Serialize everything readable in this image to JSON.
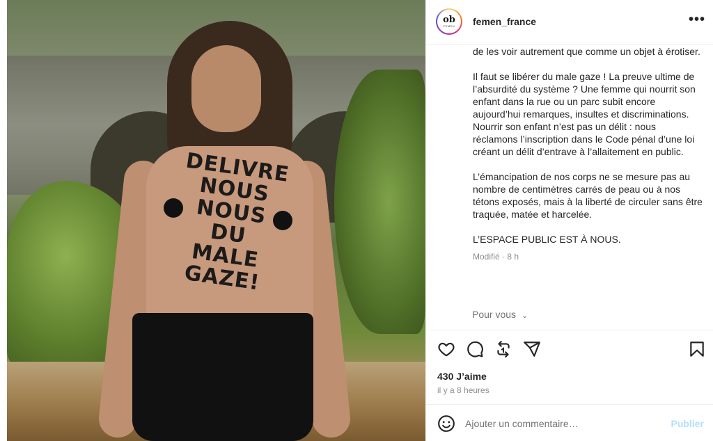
{
  "post": {
    "username": "femen_france",
    "avatar_logo": "ob",
    "avatar_sub": "FEMEN",
    "more_label": "•••",
    "photo_writing": [
      "DELIVRE",
      "NOUS",
      "NOUS",
      "DU",
      "MALE",
      "GAZE!"
    ],
    "caption": [
      "de les voir autrement que comme un objet à érotiser.",
      "Il faut se libérer du male gaze ! La preuve ultime de l’absurdité du système ? Une femme qui nourrit son enfant dans la rue ou un parc subit encore aujourd’hui remarques, insultes et discriminations. Nourrir son enfant n’est pas un délit : nous réclamons l’inscription dans le Code pénal d’une loi créant un délit d’entrave à l’allaitement en public.",
      "L’émancipation de nos corps ne se mesure pas au nombre de centimètres carrés de peau ou à nos tétons exposés, mais à la liberté de circuler sans être traquée, matée et harcelée.",
      "L’ESPACE PUBLIC EST À NOUS."
    ],
    "meta": "Modifié · 8 h",
    "pour_vous": "Pour vous",
    "likes": "430 J’aime",
    "time_ago": "il y a 8 heures"
  },
  "icons": {
    "like": "heart-icon",
    "comment": "comment-icon",
    "share": "repost-icon",
    "send": "send-icon",
    "save": "bookmark-icon",
    "emoji": "emoji-icon",
    "more": "more-icon"
  },
  "comment_box": {
    "placeholder": "Ajouter un commentaire…",
    "publish_label": "Publier"
  },
  "colors": {
    "publish_disabled": "#b2dffc",
    "border": "#efefef",
    "text": "#262626",
    "muted": "#8e8e8e"
  }
}
